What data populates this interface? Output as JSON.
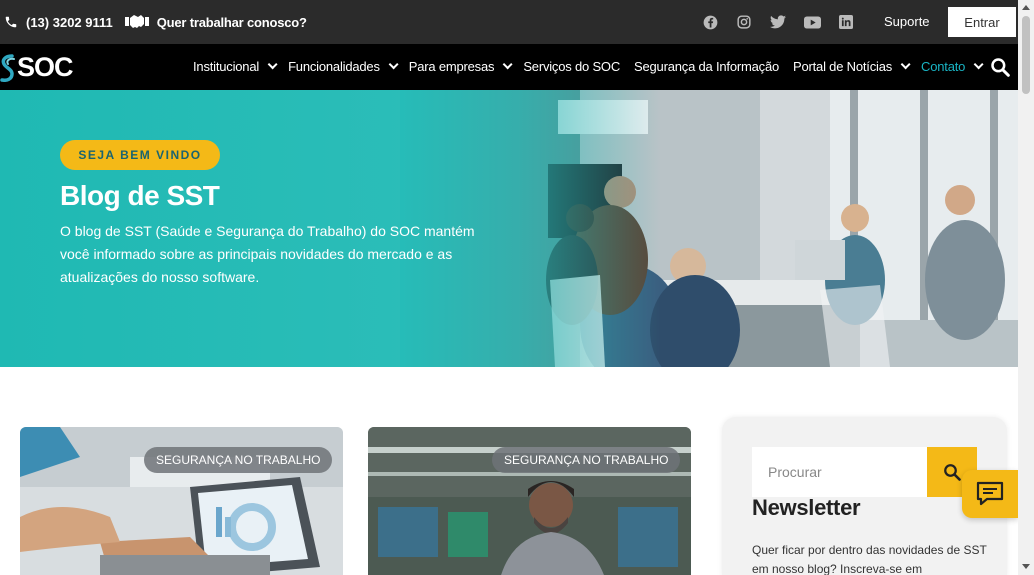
{
  "topbar": {
    "phone": "(13) 3202 9111",
    "work_link": "Quer trabalhar conosco?",
    "social_icons": [
      "facebook-icon",
      "instagram-icon",
      "twitter-icon",
      "youtube-icon",
      "linkedin-icon"
    ],
    "support_label": "Suporte",
    "login_label": "Entrar"
  },
  "nav": {
    "logo_text": "SOC",
    "items": [
      {
        "label": "Institucional",
        "has_dropdown": true
      },
      {
        "label": "Funcionalidades",
        "has_dropdown": true
      },
      {
        "label": "Para empresas",
        "has_dropdown": true
      },
      {
        "label": "Serviços do SOC",
        "has_dropdown": false
      },
      {
        "label": "Segurança da Informação",
        "has_dropdown": false
      },
      {
        "label": "Portal de Notícias",
        "has_dropdown": true
      },
      {
        "label": "Contato",
        "has_dropdown": true,
        "active": true
      }
    ]
  },
  "hero": {
    "badge": "SEJA BEM VINDO",
    "title": "Blog de SST",
    "description": "O blog de SST (Saúde e Segurança do Trabalho) do SOC mantém você informado sobre as principais novidades do mercado e as atualizações do nosso software."
  },
  "cards": [
    {
      "tag": "SEGURANÇA NO TRABALHO"
    },
    {
      "tag": "SEGURANÇA NO TRABALHO"
    }
  ],
  "sidebar": {
    "search_placeholder": "Procurar",
    "newsletter_title": "Newsletter",
    "newsletter_text": "Quer ficar por dentro das novidades de SST em nosso blog? Inscreva-se em"
  },
  "colors": {
    "accent_yellow": "#f4b917",
    "brand_teal": "#1fb9b3",
    "nav_active": "#19b4c4",
    "topbar_bg": "#2b2b2b",
    "nav_bg": "#000000"
  }
}
